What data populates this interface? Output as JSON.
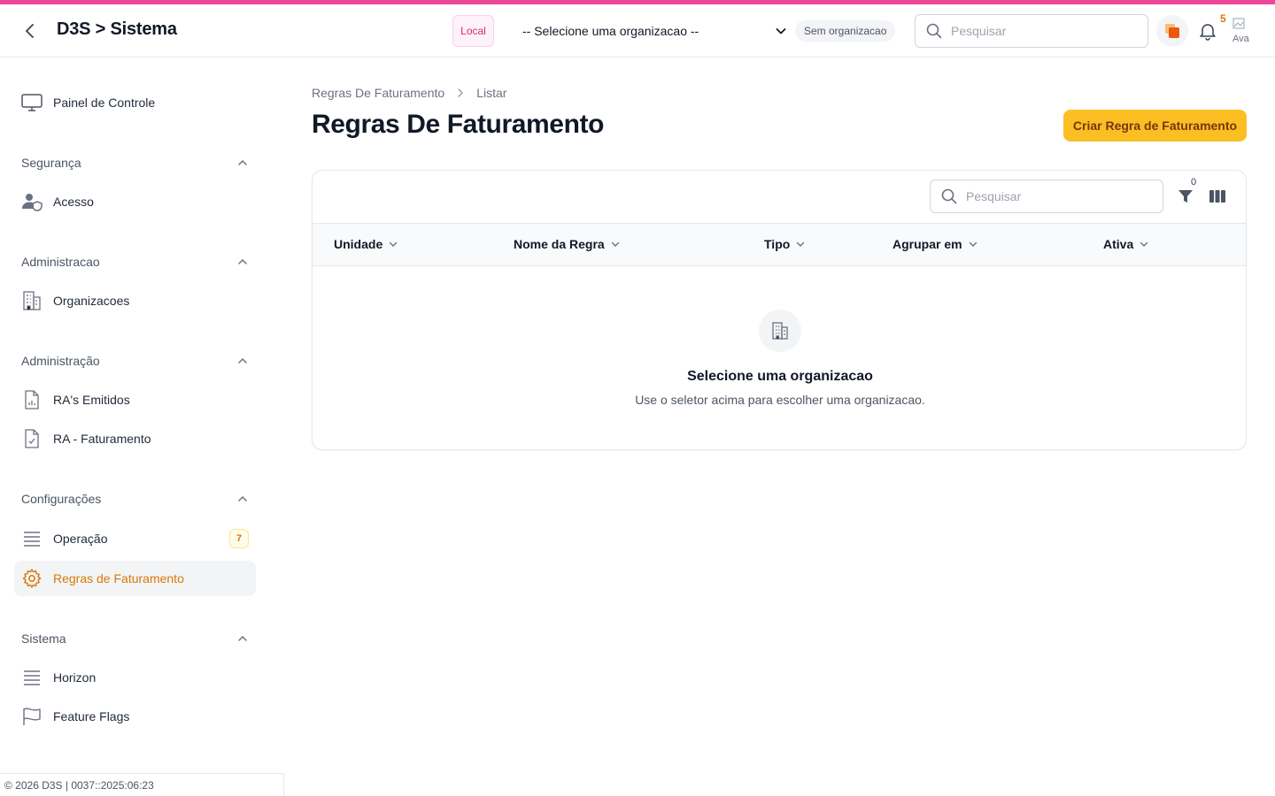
{
  "header": {
    "title": "D3S > Sistema",
    "env_badge": "Local",
    "org_select_value": "-- Selecione uma organizacao --",
    "org_status": "Sem organizacao",
    "search_placeholder": "Pesquisar",
    "notification_count": "5",
    "avatar_alt": "Ava"
  },
  "sidebar": {
    "dashboard": "Painel de Controle",
    "groups": {
      "seguranca": "Segurança",
      "administracao1": "Administracao",
      "administracao2": "Administração",
      "configuracoes": "Configurações",
      "sistema": "Sistema"
    },
    "items": {
      "acesso": "Acesso",
      "organizacoes": "Organizacoes",
      "ras_emitidos": "RA's Emitidos",
      "ra_faturamento": "RA - Faturamento",
      "operacao": "Operação",
      "operacao_badge": "7",
      "regras_faturamento": "Regras de Faturamento",
      "horizon": "Horizon",
      "feature_flags": "Feature Flags"
    },
    "footer": "© 2026 D3S | 0037::2025:06:23"
  },
  "main": {
    "breadcrumb": [
      "Regras De Faturamento",
      "Listar"
    ],
    "title": "Regras De Faturamento",
    "create_button": "Criar Regra de Faturamento",
    "table": {
      "search_placeholder": "Pesquisar",
      "filter_count": "0",
      "columns": [
        "Unidade",
        "Nome da Regra",
        "Tipo",
        "Agrupar em",
        "Ativa"
      ],
      "empty_title": "Selecione uma organizacao",
      "empty_description": "Use o seletor acima para escolher uma organizacao."
    }
  },
  "colors": {
    "accent": "#ec4899",
    "primary": "#fbbf24",
    "active_text": "#d97706"
  }
}
